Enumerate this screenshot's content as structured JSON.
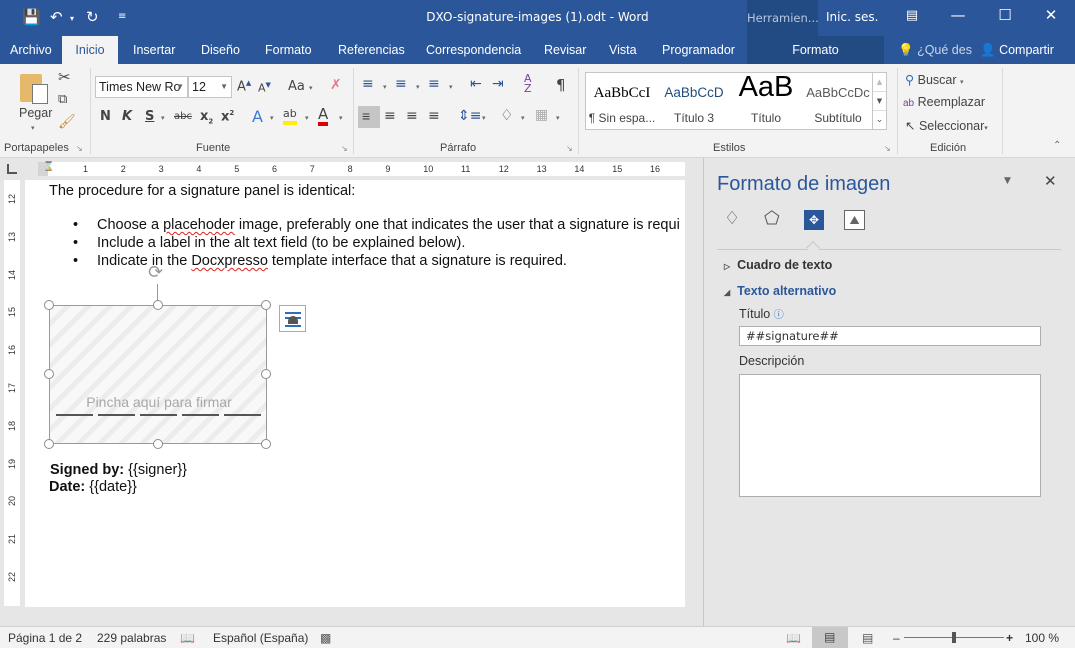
{
  "titlebar": {
    "title": "DXO-signature-images (1).odt  -  Word",
    "contextual_header": "Herramien...",
    "signin": "Inic. ses.",
    "qat": {
      "save": "save-icon",
      "undo": "undo-icon",
      "redo": "redo-icon",
      "customize": "customize-qat-icon"
    }
  },
  "tabs": [
    {
      "label": "Archivo"
    },
    {
      "label": "Inicio"
    },
    {
      "label": "Insertar"
    },
    {
      "label": "Diseño"
    },
    {
      "label": "Formato"
    },
    {
      "label": "Referencias"
    },
    {
      "label": "Correspondencia"
    },
    {
      "label": "Revisar"
    },
    {
      "label": "Vista"
    },
    {
      "label": "Programador"
    },
    {
      "label": "Formato"
    }
  ],
  "tell_me": "¿Qué des",
  "share": "Compartir",
  "ribbon": {
    "clipboard": {
      "paste": "Pegar",
      "group": "Portapapeles"
    },
    "font": {
      "name": "Times New Ro",
      "size": "12",
      "group": "Fuente",
      "bold": "N",
      "italic": "K",
      "underline": "S",
      "strike": "abc",
      "case": "Aa"
    },
    "paragraph": {
      "group": "Párrafo"
    },
    "styles": {
      "group": "Estilos",
      "items": [
        {
          "preview": "AaBbCcI",
          "name": "¶ Sin espa..."
        },
        {
          "preview": "AaBbCcD",
          "name": "Título 3"
        },
        {
          "preview": "AaB",
          "name": "Título"
        },
        {
          "preview": "AaBbCcDc",
          "name": "Subtítulo"
        }
      ]
    },
    "editing": {
      "group": "Edición",
      "find": "Buscar",
      "replace": "Reemplazar",
      "select": "Seleccionar"
    }
  },
  "ruler": {
    "h_ticks": [
      "1",
      "2",
      "3",
      "4",
      "5",
      "6",
      "7",
      "8",
      "9",
      "10",
      "11",
      "12",
      "13",
      "14",
      "15",
      "16"
    ],
    "v_ticks": [
      "12",
      "13",
      "14",
      "15",
      "16",
      "17",
      "18",
      "19",
      "20",
      "21",
      "22"
    ]
  },
  "document": {
    "intro": "The procedure for a signature panel is identical:",
    "bullets": [
      {
        "pre": "Choose a ",
        "err": "placehoder",
        "post": " image, preferably one that indicates the user that a signature is requi"
      },
      {
        "pre": "Include a label in the alt text field (to be explained below).",
        "err": "",
        "post": ""
      },
      {
        "pre": "Indicate in the ",
        "err": "Docxpresso",
        "post": " template interface that a signature is required."
      }
    ],
    "signature_placeholder": "Pincha aquí para firmar",
    "signed_by_label": "Signed by:",
    "signed_by_value": " {{signer}}",
    "date_label": "Date:",
    "date_value": " {{date}}"
  },
  "pane": {
    "title": "Formato de imagen",
    "section_textbox": "Cuadro de texto",
    "section_alt": "Texto alternativo",
    "title_label": "Título",
    "title_value": "##signature##",
    "desc_label": "Descripción",
    "desc_value": ""
  },
  "status": {
    "page": "Página 1 de 2",
    "words": "229 palabras",
    "language": "Español (España)",
    "zoom": "100 %",
    "zoom_level": 100
  }
}
